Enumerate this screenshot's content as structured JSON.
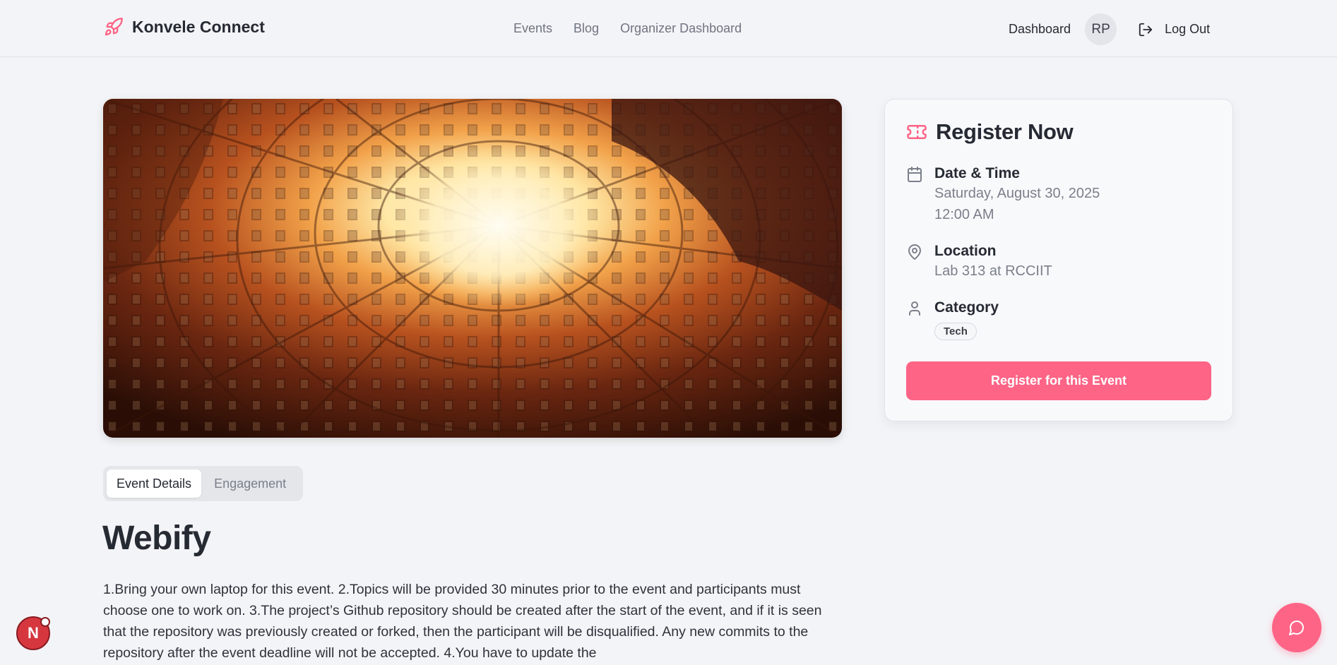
{
  "header": {
    "brand": "Konvele Connect",
    "brand_icon": "rocket-icon",
    "nav": [
      "Events",
      "Blog",
      "Organizer Dashboard"
    ],
    "dashboard": "Dashboard",
    "avatar_initials": "RP",
    "logout": "Log Out"
  },
  "tabs": [
    "Event Details",
    "Engagement"
  ],
  "event": {
    "title": "Webify",
    "description": "1.Bring your own laptop for this event. 2.Topics will be provided 30 minutes prior to the event and participants must choose one to work on. 3.The project’s Github repository should be created after the start of the event, and if it is seen that the repository was previously created or forked, then the participant will be disqualified. Any new commits to the repository after the event deadline will not be accepted. 4.You have to update the"
  },
  "register_card": {
    "title": "Register Now",
    "date_label": "Date & Time",
    "date": "Saturday, August 30, 2025",
    "time": "12:00 AM",
    "location_label": "Location",
    "location": "Lab 313 at RCCIIT",
    "category_label": "Category",
    "category": "Tech",
    "button": "Register for this Event"
  },
  "floating": {
    "dev_badge": "N",
    "chat_icon": "chat-bubble-icon"
  },
  "colors": {
    "accent": "#fe6486",
    "background": "#f3f4f7",
    "text": "#262a33",
    "muted": "#7a7f8a"
  }
}
